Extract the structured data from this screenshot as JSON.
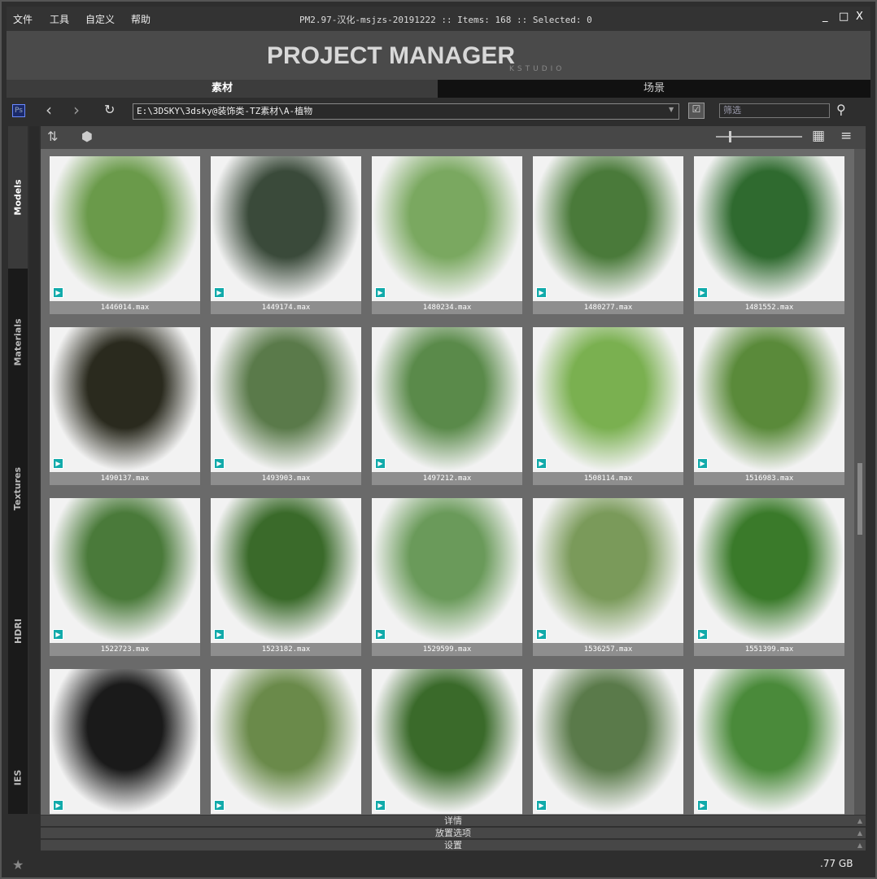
{
  "menu": [
    "文件",
    "工具",
    "自定义",
    "帮助"
  ],
  "title": "PM2.97-汉化-msjzs-20191222  :: Items: 168  :: Selected: 0",
  "window_buttons": {
    "minimize": "_",
    "maximize": "□",
    "close": "X"
  },
  "logo": {
    "text": "PROJECT MANAGER",
    "sub": "KSTUDIO"
  },
  "tabs": [
    {
      "label": "素材",
      "active": true
    },
    {
      "label": "场景",
      "active": false
    }
  ],
  "toolbar": {
    "path": "E:\\3DSKY\\3dsky@装饰类-TZ素材\\A-植物",
    "filter_placeholder": "筛选",
    "ps_icon": "Ps"
  },
  "sidebar": [
    {
      "label": "Models",
      "active": true
    },
    {
      "label": "Materials"
    },
    {
      "label": "Textures"
    },
    {
      "label": "HDRI"
    },
    {
      "label": "IES"
    }
  ],
  "items": [
    {
      "name": "1446014.max",
      "tone": "#6a9a4a"
    },
    {
      "name": "1449174.max",
      "tone": "#3a4a3a"
    },
    {
      "name": "1480234.max",
      "tone": "#7aa860"
    },
    {
      "name": "1480277.max",
      "tone": "#4a7a3a"
    },
    {
      "name": "1481552.max",
      "tone": "#2f6a2f"
    },
    {
      "name": "1490137.max",
      "tone": "#2a2a1e"
    },
    {
      "name": "1493903.max",
      "tone": "#5a7a4a"
    },
    {
      "name": "1497212.max",
      "tone": "#5a8a4a"
    },
    {
      "name": "1508114.max",
      "tone": "#7ab050"
    },
    {
      "name": "1516983.max",
      "tone": "#5a8a3a"
    },
    {
      "name": "1522723.max",
      "tone": "#4a7a3a"
    },
    {
      "name": "1523182.max",
      "tone": "#3a6a2a"
    },
    {
      "name": "1529599.max",
      "tone": "#6a9a5a"
    },
    {
      "name": "1536257.max",
      "tone": "#7a9a5a"
    },
    {
      "name": "1551399.max",
      "tone": "#3a7a2a"
    },
    {
      "name": "",
      "tone": "#1a1a1a"
    },
    {
      "name": "",
      "tone": "#6a8a4a"
    },
    {
      "name": "",
      "tone": "#3a6a2a"
    },
    {
      "name": "",
      "tone": "#5a7a4a"
    },
    {
      "name": "",
      "tone": "#4a8a3a"
    }
  ],
  "panels": [
    "详情",
    "放置选项",
    "设置"
  ],
  "status": {
    "size": ".77 GB"
  },
  "zoom_slider": 0.15
}
